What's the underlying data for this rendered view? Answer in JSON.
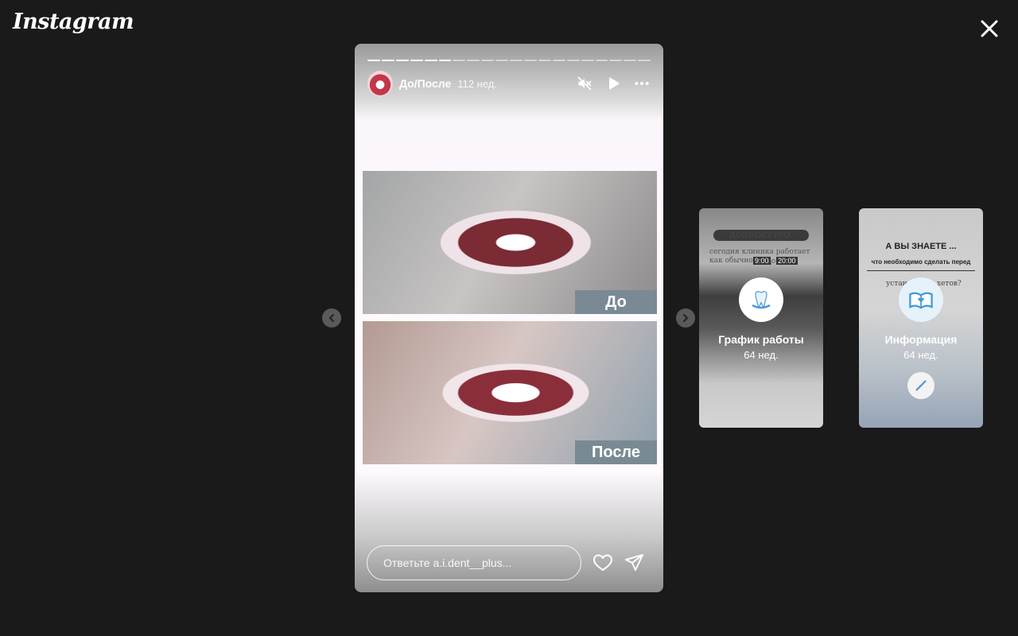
{
  "app": {
    "logo": "Instagram"
  },
  "story": {
    "author": "До/После",
    "time": "112 нед.",
    "segments_total": 20,
    "segments_done": 6,
    "label_before": "До",
    "label_after": "После",
    "reply_placeholder": "Ответьте a.i.dent__plus..."
  },
  "previews": [
    {
      "title": "График работы",
      "time": "64 нед.",
      "bg_lines": {
        "l1": "ДОБРОЕУТРО",
        "l2": "сегодня клиника работает",
        "l3": "как обычно с",
        "hour_from": "9:00",
        "to": "до",
        "hour_to": "20:00"
      }
    },
    {
      "title": "Информация",
      "time": "64 нед.",
      "bg_lines": {
        "l1": "А ВЫ ЗНАЕТЕ ...",
        "l2": "что необходимо сделать перед",
        "l3": "устан",
        "l4": "хетов?"
      }
    }
  ],
  "colors": {
    "background": "#1a1a1a",
    "label_bg": "#7a8a94"
  }
}
